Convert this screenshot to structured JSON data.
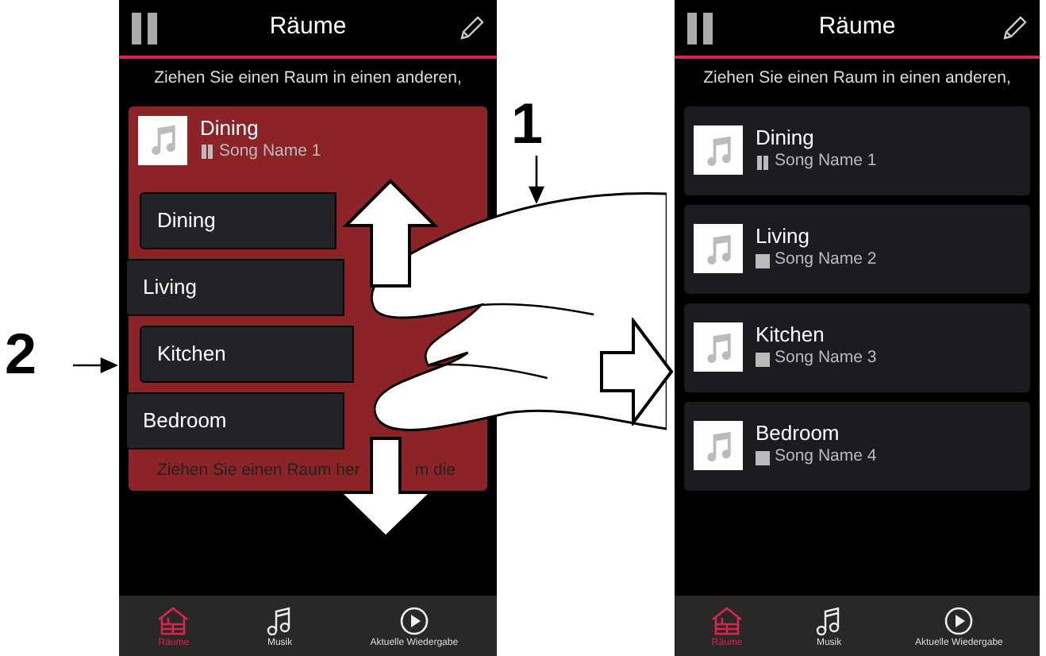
{
  "callouts": [
    "1",
    "2"
  ],
  "phones": [
    {
      "title": "Räume",
      "hint": "Ziehen Sie einen Raum in einen anderen,",
      "group": {
        "room": "Dining",
        "song": "Song Name 1",
        "playing": true,
        "members": [
          {
            "name": "Dining",
            "kind": "inside"
          },
          {
            "name": "Living",
            "kind": "outside"
          },
          {
            "name": "Kitchen",
            "kind": "inside"
          },
          {
            "name": "Bedroom",
            "kind": "outside"
          }
        ],
        "hint_parts": [
          "Ziehen Sie einen Raum her",
          "m die"
        ]
      },
      "tabs": [
        {
          "label": "Räume",
          "selected": true
        },
        {
          "label": "Musik",
          "selected": false
        },
        {
          "label": "Aktuelle Wiedergabe",
          "selected": false
        }
      ]
    },
    {
      "title": "Räume",
      "hint": "Ziehen Sie einen Raum in einen anderen,",
      "rooms": [
        {
          "room": "Dining",
          "song": "Song Name 1",
          "playing": true
        },
        {
          "room": "Living",
          "song": "Song Name 2",
          "playing": false
        },
        {
          "room": "Kitchen",
          "song": "Song Name 3",
          "playing": false
        },
        {
          "room": "Bedroom",
          "song": "Song Name 4",
          "playing": false
        }
      ],
      "tabs": [
        {
          "label": "Räume",
          "selected": true
        },
        {
          "label": "Musik",
          "selected": false
        },
        {
          "label": "Aktuelle Wiedergabe",
          "selected": false
        }
      ]
    }
  ]
}
